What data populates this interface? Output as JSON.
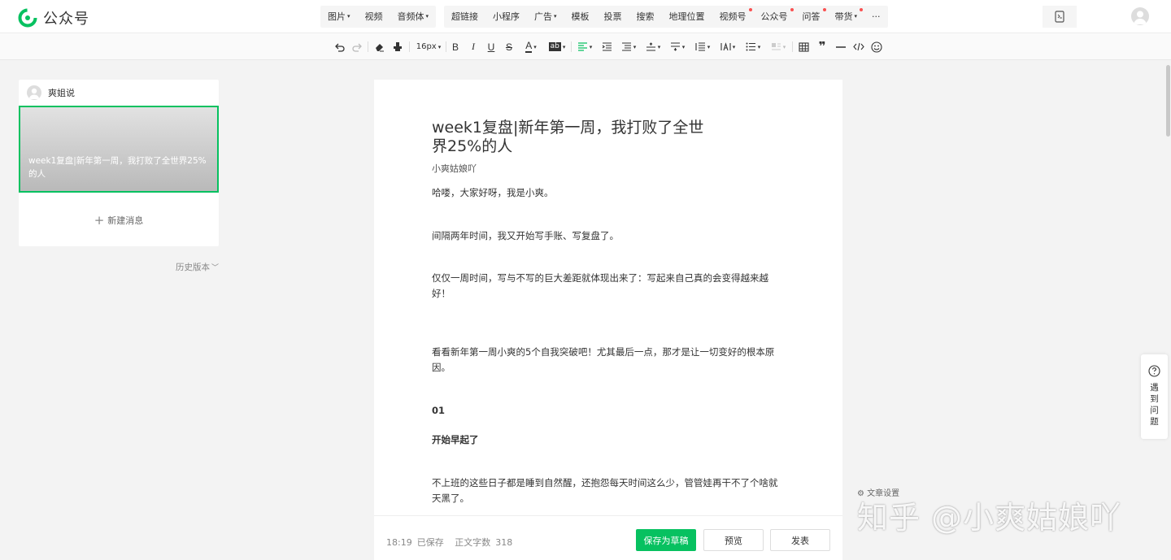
{
  "app": {
    "title": "公众号",
    "brand_color": "#07c160"
  },
  "top_menu": {
    "group1": [
      {
        "label": "图片",
        "caret": true,
        "dot": false
      },
      {
        "label": "视频",
        "caret": false,
        "dot": false
      },
      {
        "label": "音频体",
        "caret": true,
        "dot": false
      }
    ],
    "group2": [
      {
        "label": "超链接",
        "caret": false,
        "dot": false
      },
      {
        "label": "小程序",
        "caret": false,
        "dot": false
      },
      {
        "label": "广告",
        "caret": true,
        "dot": false
      },
      {
        "label": "模板",
        "caret": false,
        "dot": false
      },
      {
        "label": "投票",
        "caret": false,
        "dot": false
      },
      {
        "label": "搜索",
        "caret": false,
        "dot": false
      },
      {
        "label": "地理位置",
        "caret": false,
        "dot": false
      },
      {
        "label": "视频号",
        "caret": false,
        "dot": true
      },
      {
        "label": "公众号",
        "caret": false,
        "dot": true
      },
      {
        "label": "问答",
        "caret": false,
        "dot": true
      },
      {
        "label": "带货",
        "caret": true,
        "dot": true
      },
      {
        "label": "···",
        "caret": false,
        "dot": false
      }
    ]
  },
  "toolbar": {
    "font_size": "16px",
    "bold_label": "B",
    "italic_label": "I",
    "underline_label": "U",
    "strike_label": "S",
    "font_color_label": "A",
    "bg_color_label": "ab"
  },
  "sidebar": {
    "account_name": "爽姐说",
    "cover_title": "week1复盘|新年第一周，我打败了全世界25%的人",
    "new_message": "新建消息",
    "history": "历史版本"
  },
  "article": {
    "title": "week1复盘|新年第一周，我打败了全世界25%的人",
    "author": "小爽姑娘吖",
    "paragraphs": [
      "哈喽，大家好呀，我是小爽。",
      "间隔两年时间，我又开始写手账、写复盘了。",
      "仅仅一周时间，写与不写的巨大差距就体现出来了：写起来自己真的会变得越来越好！",
      "看看新年第一周小爽的5个自我突破吧！尤其最后一点，那才是让一切变好的根本原因。",
      "01",
      "开始早起了",
      "不上班的这些日子都是睡到自然醒，还抱怨每天时间这么少，管管娃再干不了个啥就天黑了。"
    ]
  },
  "footer": {
    "time": "18:19",
    "saved": "已保存",
    "word_count_label": "正文字数",
    "word_count": "318",
    "save_draft": "保存为草稿",
    "preview": "预览",
    "publish": "发表"
  },
  "help": {
    "label": "遇到问题"
  },
  "article_settings": "文章设置",
  "watermark": "知乎 @小爽姑娘吖"
}
